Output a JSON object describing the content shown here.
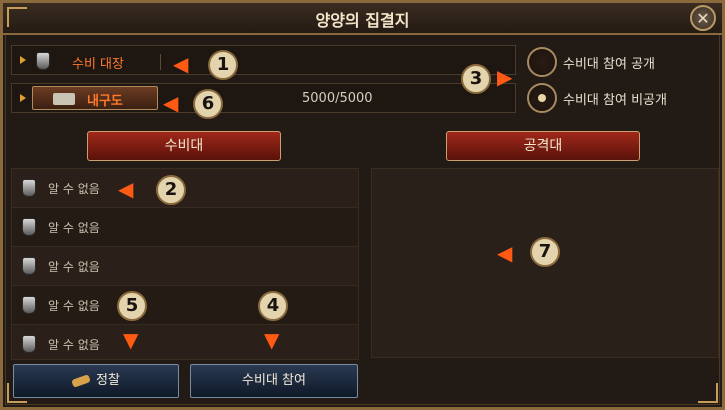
{
  "window": {
    "title": "양양의 집결지",
    "close_icon": "close-icon"
  },
  "top": {
    "captain_label": "수비 대장",
    "naegu_label": "내구도",
    "durability": "5000/5000"
  },
  "visibility": {
    "public_label": "수비대 참여 공개",
    "private_label": "수비대 참여 비공개",
    "selected": "private"
  },
  "sections": {
    "defense": "수비대",
    "attack": "공격대"
  },
  "defense_list": [
    {
      "name": "알 수 없음"
    },
    {
      "name": "알 수 없음"
    },
    {
      "name": "알 수 없음"
    },
    {
      "name": "알 수 없음"
    },
    {
      "name": "알 수 없음"
    }
  ],
  "buttons": {
    "scout": "정찰",
    "join": "수비대 참여"
  },
  "annotations": [
    "1",
    "2",
    "3",
    "4",
    "5",
    "6",
    "7"
  ],
  "colors": {
    "accent_orange": "#ff7a2a",
    "badge": "#e3d4ae",
    "arrow": "#ff5a14",
    "section_red": "#a0281a"
  }
}
